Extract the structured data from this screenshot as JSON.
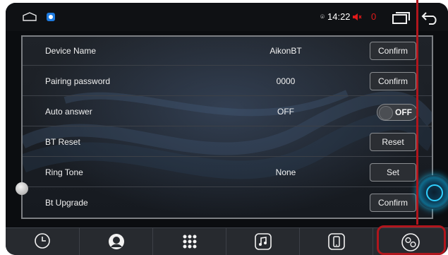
{
  "statusbar": {
    "time": "14:22",
    "volume": "0",
    "icons": [
      "home-icon",
      "app-badge-icon",
      "location-icon",
      "volume-mute-icon",
      "recent-apps-icon",
      "back-icon"
    ]
  },
  "settings": {
    "rows": [
      {
        "label": "Device Name",
        "value": "AikonBT",
        "action": "Confirm"
      },
      {
        "label": "Pairing password",
        "value": "0000",
        "action": "Confirm"
      },
      {
        "label": "Auto answer",
        "value": "OFF",
        "toggle": "OFF"
      },
      {
        "label": "BT Reset",
        "value": "",
        "action": "Reset"
      },
      {
        "label": "Ring Tone",
        "value": "None",
        "action": "Set"
      },
      {
        "label": "Bt Upgrade",
        "value": "",
        "action": "Confirm"
      }
    ]
  },
  "dock": {
    "items": [
      "call-log-icon",
      "contacts-icon",
      "dialpad-icon",
      "music-icon",
      "phone-device-icon",
      "settings-link-icon"
    ],
    "highlighted_index": 5
  },
  "colors": {
    "annotation_red": "#b0161d",
    "volume_red": "#e01a1a",
    "badge_blue": "#1e7be0"
  }
}
